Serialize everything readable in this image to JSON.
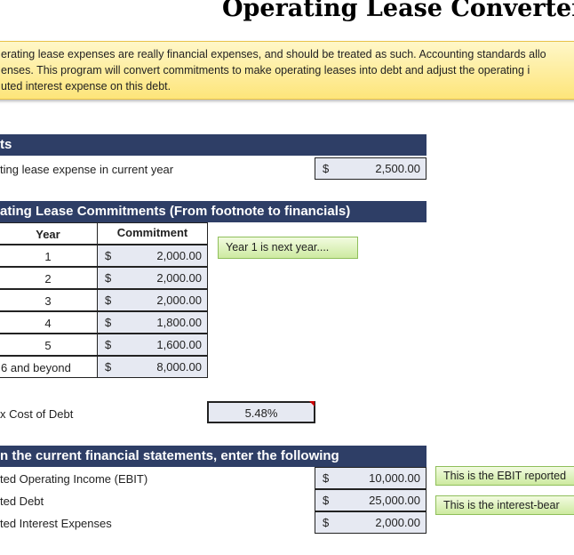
{
  "title": "Operating Lease Converter",
  "intro": [
    "erating lease expenses are really financial expenses, and should be treated as such. Accounting standards allo",
    "enses. This program will convert commitments to make operating leases into debt and adjust the operating i",
    "uted interest expense on this debt."
  ],
  "inputs": {
    "header": "ts",
    "expense_label": "ting lease expense in current year",
    "currency": "$",
    "expense_value": "2,500.00"
  },
  "commitments": {
    "header": "ating Lease Commitments (From footnote to financials)",
    "col_year": "Year",
    "col_commitment": "Commitment",
    "rows": [
      {
        "year": "1",
        "value": "2,000.00"
      },
      {
        "year": "2",
        "value": "2,000.00"
      },
      {
        "year": "3",
        "value": "2,000.00"
      },
      {
        "year": "4",
        "value": "1,800.00"
      },
      {
        "year": "5",
        "value": "1,600.00"
      },
      {
        "year": "6 and beyond",
        "value": "8,000.00"
      }
    ],
    "note": "Year 1 is next year...."
  },
  "cost_of_debt": {
    "label": "x Cost of Debt",
    "value": "5.48%"
  },
  "financials": {
    "header": "n the current financial statements, enter the following",
    "rows": [
      {
        "label": "ted Operating Income (EBIT)",
        "value": "10,000.00"
      },
      {
        "label": "ted Debt",
        "value": "25,000.00"
      },
      {
        "label": "ted Interest Expenses",
        "value": "2,000.00"
      }
    ],
    "notes": [
      "This is the EBIT reported",
      "This is the interest-bear"
    ]
  },
  "colors": {
    "header": "#2e3e66",
    "input_bg": "#e6e9f2",
    "banner": "#fde57a",
    "note": "#cdeaa0"
  }
}
